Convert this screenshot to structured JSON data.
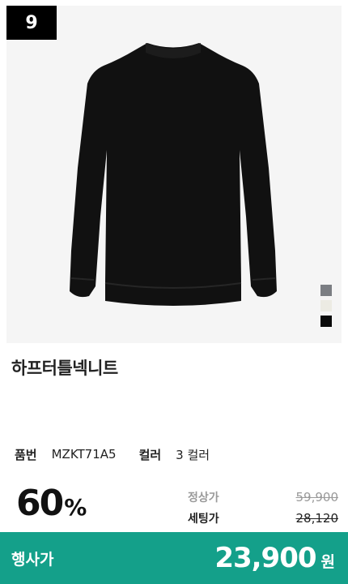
{
  "rank": "9",
  "product": {
    "name": "하프터틀넥니트",
    "code_label": "품번",
    "code": "MZKT71A5",
    "color_label": "컬러",
    "color_count": "3 컬러"
  },
  "swatches": [
    {
      "name": "gray",
      "color": "#7b7e83"
    },
    {
      "name": "ivory",
      "color": "#ecebe3"
    },
    {
      "name": "black",
      "color": "#0a0a0a"
    }
  ],
  "pricing": {
    "discount": "60",
    "discount_unit": "%",
    "regular_label": "정상가",
    "regular_price": "59,900",
    "set_label": "세팅가",
    "set_price": "28,120"
  },
  "event": {
    "label": "행사가",
    "price": "23,900",
    "unit": "원",
    "color": "#14a08a"
  }
}
